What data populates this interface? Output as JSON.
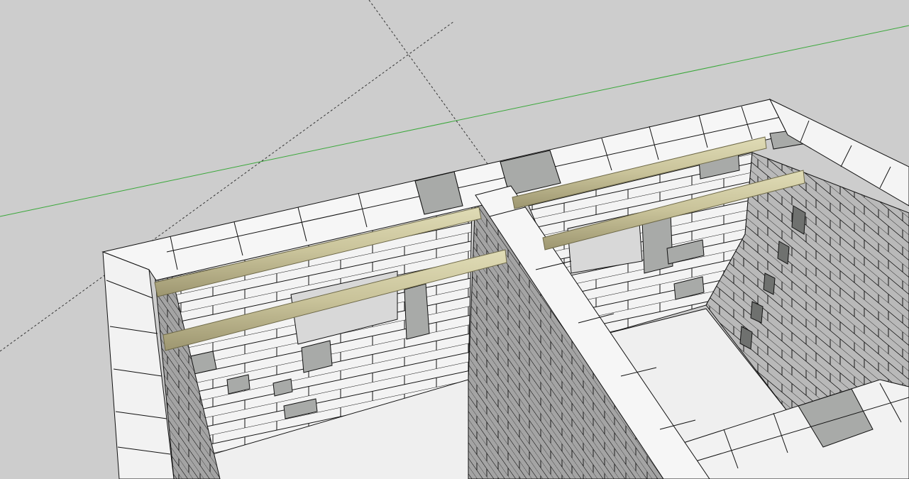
{
  "scene": {
    "description_free": true,
    "colors": {
      "sky": "#cdcdcd",
      "block_light": "#f4f4f4",
      "block_mid": "#e6e6e6",
      "block_side": "#d6d6d6",
      "block_gray": "#a9aba9",
      "block_dark": "#8a8c8a",
      "wall_shadow": "#9a9a9a",
      "floor": "#efefef",
      "beam": "#c8c49c",
      "beam_edge": "#8f8a62",
      "green_axis": "#3aa83a",
      "dashed_axis": "#333333",
      "edge": "#111111"
    }
  }
}
